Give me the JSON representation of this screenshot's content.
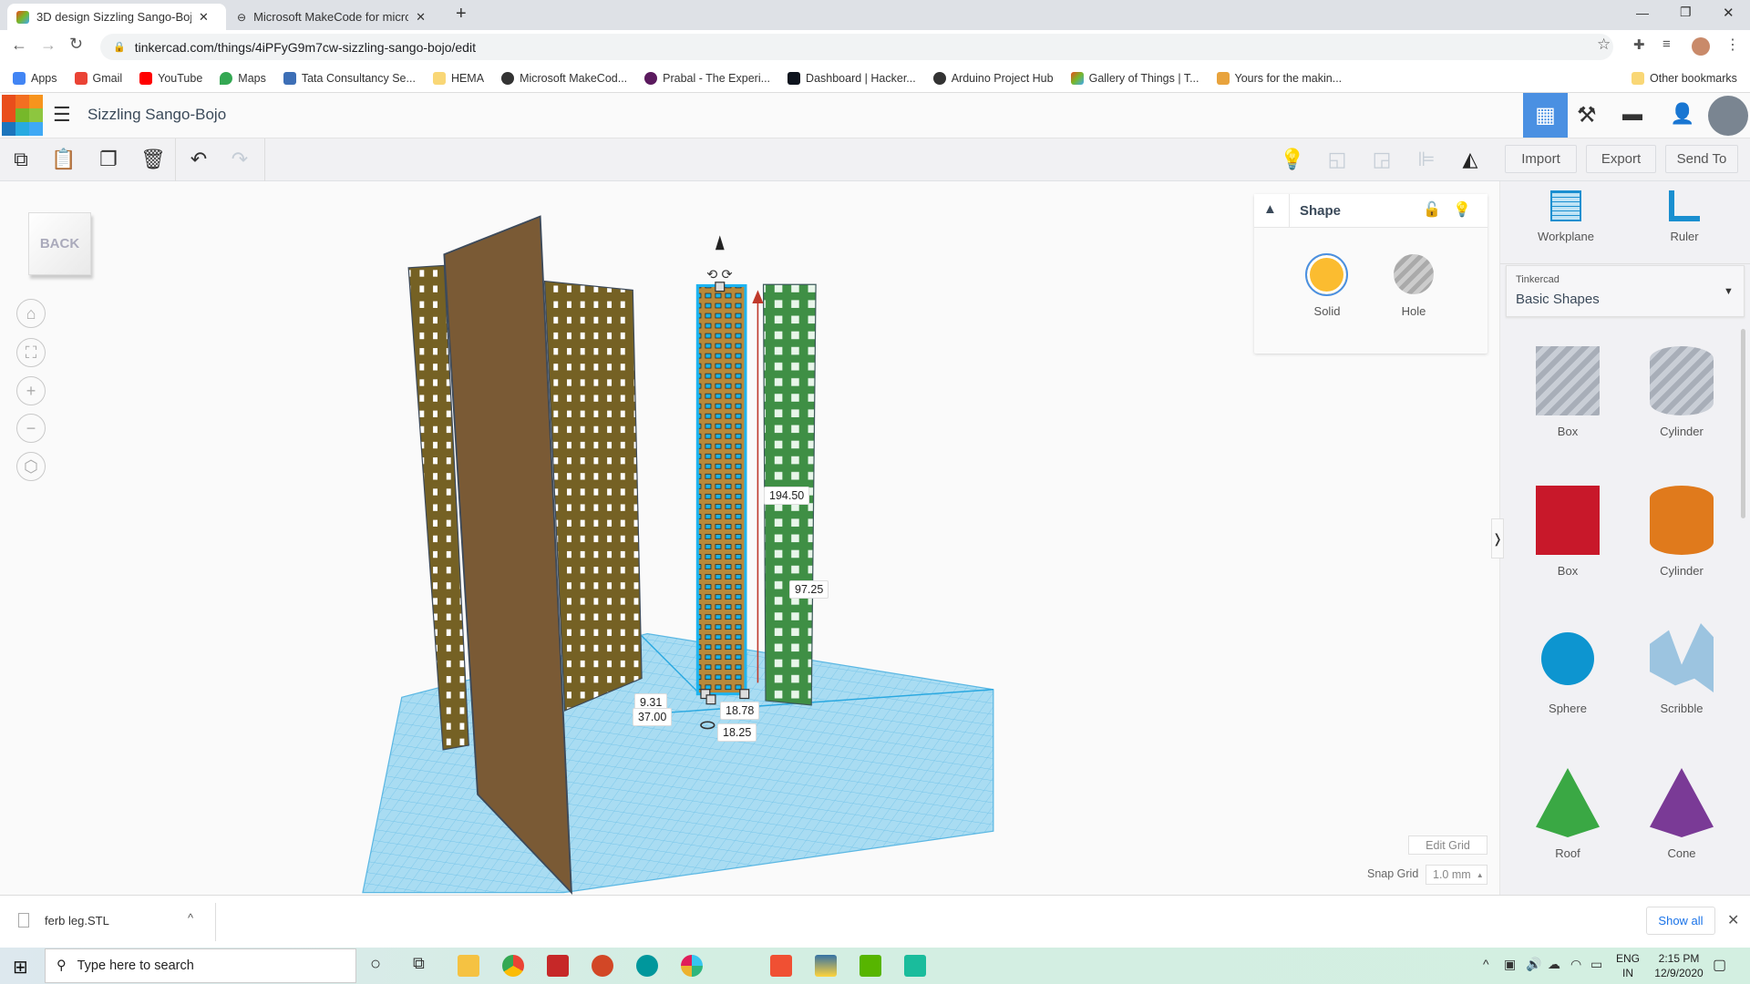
{
  "browser": {
    "tabs": [
      {
        "label": "3D design Sizzling Sango-Bojo | T",
        "active": true
      },
      {
        "label": "Microsoft MakeCode for micro:bit",
        "active": false
      }
    ],
    "url": "tinkercad.com/things/4iPFyG9m7cw-sizzling-sango-bojo/edit",
    "bookmarks": [
      {
        "label": "Apps",
        "color": "#4285f4"
      },
      {
        "label": "Gmail",
        "color": "#ea4335"
      },
      {
        "label": "YouTube",
        "color": "#ff0000"
      },
      {
        "label": "Maps",
        "color": "#34a853"
      },
      {
        "label": "Tata Consultancy Se...",
        "color": "#3d6fb6"
      },
      {
        "label": "HEMA",
        "color": "#f9d776"
      },
      {
        "label": "Microsoft MakeCod...",
        "color": "#333333"
      },
      {
        "label": "Prabal - The Experi...",
        "color": "#5b1a5e"
      },
      {
        "label": "Dashboard | Hacker...",
        "color": "#0e141e"
      },
      {
        "label": "Arduino Project Hub",
        "color": "#333333"
      },
      {
        "label": "Gallery of Things | T...",
        "color": "#e94e1b"
      },
      {
        "label": "Yours for the makin...",
        "color": "#e8a33d"
      }
    ],
    "other_bookmarks": "Other bookmarks"
  },
  "app": {
    "logo_letters": [
      "T",
      "I",
      "N",
      "K",
      "E",
      "R",
      "C",
      "A",
      "D"
    ],
    "design_title": "Sizzling Sango-Bojo",
    "accent": "#4a90e2"
  },
  "toolbar": {
    "import": "Import",
    "export": "Export",
    "send_to": "Send To"
  },
  "viewport": {
    "viewcube_face": "BACK",
    "dimensions": {
      "height": "194.50",
      "elevation": "97.25",
      "d1": "9.31",
      "d2": "37.00",
      "width": "18.78",
      "depth": "18.25"
    }
  },
  "inspector": {
    "title": "Shape",
    "solid": "Solid",
    "hole": "Hole",
    "solid_color": "#fbbc30"
  },
  "panel": {
    "workplane": "Workplane",
    "ruler": "Ruler",
    "library_source": "Tinkercad",
    "library_name": "Basic Shapes",
    "shapes": [
      {
        "label": "Box",
        "color": "#b8bdc6"
      },
      {
        "label": "Cylinder",
        "color": "#b8bdc6"
      },
      {
        "label": "Box",
        "color": "#c8182a"
      },
      {
        "label": "Cylinder",
        "color": "#e07a1c"
      },
      {
        "label": "Sphere",
        "color": "#0d95d0"
      },
      {
        "label": "Scribble",
        "color": "#9cc4e0"
      },
      {
        "label": "Roof",
        "color": "#3aa844"
      },
      {
        "label": "Cone",
        "color": "#7a3a96"
      }
    ]
  },
  "grid": {
    "edit_grid": "Edit Grid",
    "snap_label": "Snap Grid",
    "snap_value": "1.0 mm"
  },
  "downloads": {
    "file": "ferb leg.STL",
    "show_all": "Show all"
  },
  "taskbar": {
    "search_placeholder": "Type here to search",
    "lang1": "ENG",
    "lang2": "IN",
    "time": "2:15 PM",
    "date": "12/9/2020"
  }
}
